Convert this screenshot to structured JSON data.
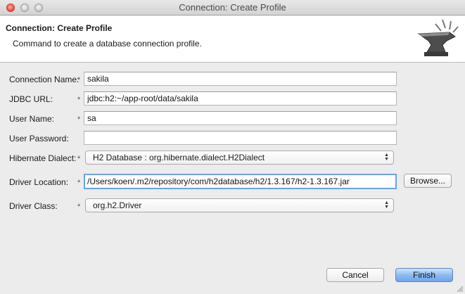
{
  "window": {
    "title": "Connection: Create Profile"
  },
  "banner": {
    "heading": "Connection: Create Profile",
    "description": "Command to create a database connection profile."
  },
  "form": {
    "connection_name": {
      "label": "Connection Name:",
      "value": "sakila",
      "required": "*"
    },
    "jdbc_url": {
      "label": "JDBC URL:",
      "value": "jdbc:h2:~/app-root/data/sakila",
      "required": "*"
    },
    "user_name": {
      "label": "User Name:",
      "value": "sa",
      "required": "*"
    },
    "user_password": {
      "label": "User Password:",
      "value": ""
    },
    "hibernate_dialect": {
      "label": "Hibernate Dialect:",
      "value": "H2 Database : org.hibernate.dialect.H2Dialect",
      "required": "*"
    },
    "driver_location": {
      "label": "Driver Location:",
      "value": "/Users/koen/.m2/repository/com/h2database/h2/1.3.167/h2-1.3.167.jar",
      "required": "*"
    },
    "driver_class": {
      "label": "Driver Class:",
      "value": "org.h2.Driver",
      "required": "*"
    },
    "browse_label": "Browse..."
  },
  "buttons": {
    "cancel": "Cancel",
    "finish": "Finish"
  },
  "colors": {
    "focus": "#6aa2e8",
    "default_button": "#8ab8f0"
  }
}
